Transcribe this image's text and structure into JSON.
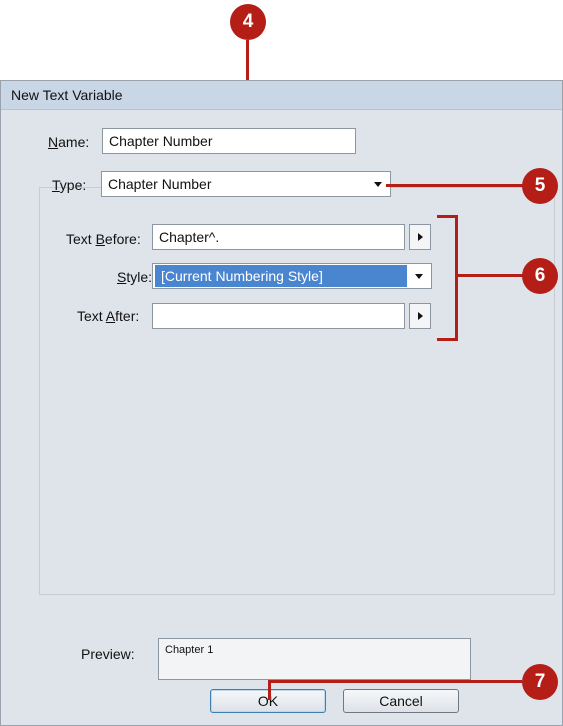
{
  "callouts": {
    "c4": "4",
    "c5": "5",
    "c6": "6",
    "c7": "7"
  },
  "dialog": {
    "title": "New Text Variable",
    "name_label_prefix": "N",
    "name_label_rest": "ame:",
    "name_value": "Chapter Number",
    "type_label_prefix": "T",
    "type_label_rest": "ype:",
    "type_value": "Chapter Number",
    "text_before_label_start": "Text ",
    "text_before_label_key": "B",
    "text_before_label_end": "efore:",
    "text_before_value": "Chapter^.",
    "style_label_key": "S",
    "style_label_rest": "tyle:",
    "style_value": "[Current Numbering Style]",
    "text_after_label_start": "Text ",
    "text_after_label_key": "A",
    "text_after_label_end": "fter:",
    "text_after_value": "",
    "preview_label": "Preview:",
    "preview_value": "Chapter 1",
    "ok_label": "OK",
    "cancel_label": "Cancel"
  },
  "colors": {
    "callout": "#b41e16",
    "selection": "#4a86cf",
    "dialog_bg": "#dfe4ea"
  }
}
